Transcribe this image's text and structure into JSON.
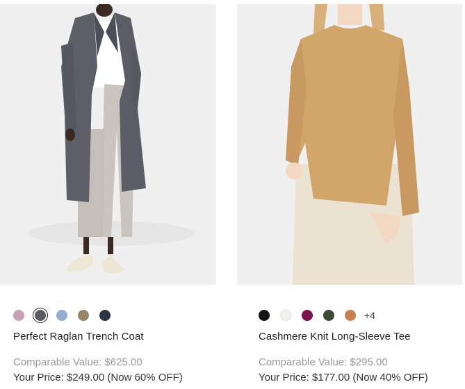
{
  "products": [
    {
      "name": "Perfect Raglan Trench Coat",
      "comparable": "Comparable Value: $625.00",
      "price": "Your Price: $249.00 (Now 60% OFF)",
      "swatches": [
        "#c9a1b7",
        "#5b5c63",
        "#93aed0",
        "#9a8466",
        "#2d3442"
      ],
      "selected_swatch": 1
    },
    {
      "name": "Cashmere Knit Long-Sleeve Tee",
      "comparable": "Comparable Value: $295.00",
      "price": "Your Price: $177.00 (Now 40% OFF)",
      "swatches": [
        "#141414",
        "#f3f1ee",
        "#7a1450",
        "#3d4a35",
        "#c77f4e"
      ],
      "more_colors": "+4"
    }
  ]
}
